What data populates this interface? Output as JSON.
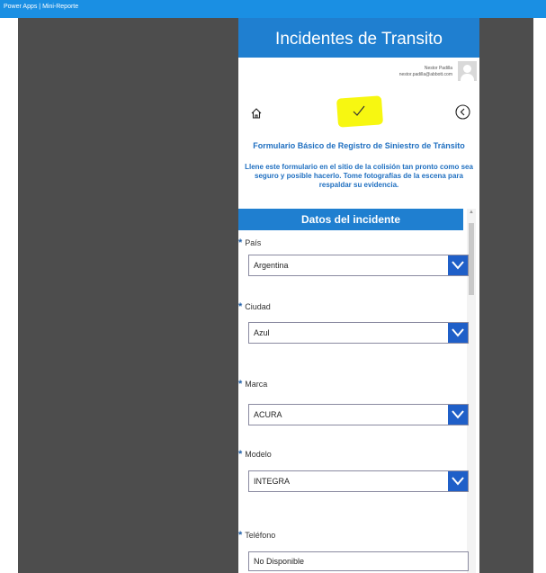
{
  "topbar": {
    "title": "Power Apps | Mini-Reporte"
  },
  "header": {
    "title": "Incidentes de Transito"
  },
  "user": {
    "name": "Nestor Padilla",
    "email": "nestor.padilla@abbott.com"
  },
  "toolbar": {
    "home_icon": "home-icon",
    "submit_icon": "checkmark-icon",
    "back_icon": "back-circle-icon",
    "highlight_color": "#f7f711"
  },
  "form": {
    "title": "Formulario Básico de Registro de Siniestro de Tránsito",
    "description": "Llene este formulario en el sitio de la colisión tan pronto como sea seguro y posible hacerlo. Tome fotografías de la escena para respaldar su evidencia."
  },
  "section": {
    "title": "Datos del incidente"
  },
  "fields": {
    "pais": {
      "label": "País",
      "value": "Argentina"
    },
    "ciudad": {
      "label": "Ciudad",
      "value": "Azul"
    },
    "marca": {
      "label": "Marca",
      "value": "ACURA"
    },
    "modelo": {
      "label": "Modelo",
      "value": "INTEGRA"
    },
    "telefono": {
      "label": "Teléfono",
      "value": "No Disponible"
    }
  },
  "required_marker": "*",
  "colors": {
    "accent": "#1f7fd0",
    "dropdown": "#1f5fc8",
    "frame": "#4d4d4d"
  }
}
